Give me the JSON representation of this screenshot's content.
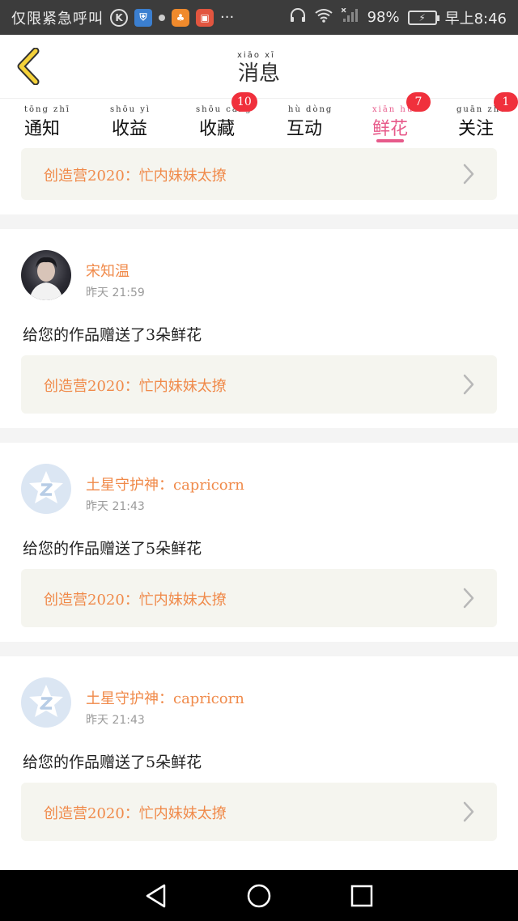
{
  "status_bar": {
    "carrier": "仅限紧急呼叫",
    "k_icon_label": "K",
    "battery": "98%",
    "time": "早上8:46",
    "more": "···"
  },
  "header": {
    "title": "消息",
    "title_pinyin": "xiāo  xī"
  },
  "tabs": [
    {
      "label": "通知",
      "pinyin": "tōng zhī",
      "badge": ""
    },
    {
      "label": "收益",
      "pinyin": "shōu yì",
      "badge": ""
    },
    {
      "label": "收藏",
      "pinyin": "shōu cáng",
      "badge": "10"
    },
    {
      "label": "互动",
      "pinyin": "hù dòng",
      "badge": ""
    },
    {
      "label": "鲜花",
      "pinyin": "xiān huā",
      "badge": "7",
      "active": true
    },
    {
      "label": "关注",
      "pinyin": "guān zhù",
      "badge": "1"
    }
  ],
  "items": [
    {
      "username": "宋知温",
      "time": "昨天 21:59",
      "message": "给您的作品赠送了3朵鲜花",
      "work_title": "创造营2020：忙内妹妹太撩"
    },
    {
      "username": "土星守护神：capricorn",
      "time": "昨天 21:43",
      "message": "给您的作品赠送了5朵鲜花",
      "work_title": "创造营2020：忙内妹妹太撩"
    },
    {
      "username": "土星守护神：capricorn",
      "time": "昨天 21:43",
      "message": "给您的作品赠送了5朵鲜花",
      "work_title": "创造营2020：忙内妹妹太撩"
    }
  ],
  "top_partial": {
    "work_title": "创造营2020：忙内妹妹太撩"
  },
  "colors": {
    "accent": "#e75a8a",
    "badge": "#f0303c",
    "username": "#f08a4a"
  }
}
